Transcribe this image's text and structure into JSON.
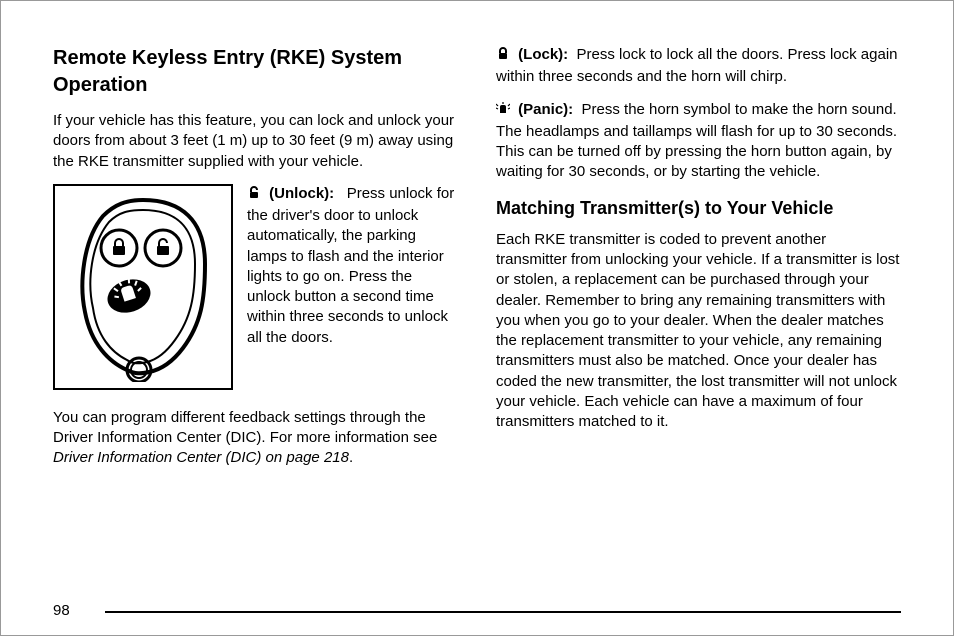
{
  "left": {
    "heading": "Remote Keyless Entry (RKE) System Operation",
    "intro": "If your vehicle has this feature, you can lock and unlock your doors from about 3 feet (1 m) up to 30 feet (9 m) away using the RKE transmitter supplied with your vehicle.",
    "unlock_label": "(Unlock):",
    "unlock_body": "Press unlock for the driver's door to unlock automatically, the parking lamps to flash and the interior lights to go on. Press the unlock button a second time within three seconds to unlock all the doors.",
    "dic_body_a": "You can program different feedback settings through the Driver Information Center (DIC). For more information see ",
    "dic_body_italic": "Driver Information Center (DIC) on page 218",
    "dic_body_b": "."
  },
  "right": {
    "lock_label": "(Lock):",
    "lock_body": "Press lock to lock all the doors. Press lock again within three seconds and the horn will chirp.",
    "panic_label": "(Panic):",
    "panic_body": "Press the horn symbol to make the horn sound. The headlamps and taillamps will flash for up to 30 seconds. This can be turned off by pressing the horn button again, by waiting for 30 seconds, or by starting the vehicle.",
    "subheading": "Matching Transmitter(s) to Your Vehicle",
    "matching_body": "Each RKE transmitter is coded to prevent another transmitter from unlocking your vehicle. If a transmitter is lost or stolen, a replacement can be purchased through your dealer. Remember to bring any remaining transmitters with you when you go to your dealer. When the dealer matches the replacement transmitter to your vehicle, any remaining transmitters must also be matched. Once your dealer has coded the new transmitter, the lost transmitter will not unlock your vehicle. Each vehicle can have a maximum of four transmitters matched to it."
  },
  "page_number": "98"
}
